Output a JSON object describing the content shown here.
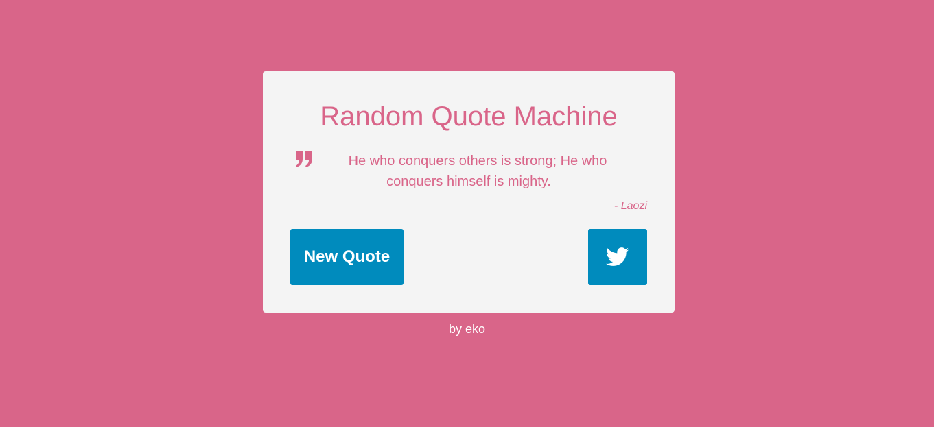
{
  "app": {
    "title": "Random Quote Machine"
  },
  "quote": {
    "text": "He who conquers others is strong; He who conquers himself is mighty.",
    "author": "- Laozi",
    "icon": "quote-right-icon"
  },
  "actions": {
    "new_quote_label": "New Quote",
    "tweet_icon": "twitter-icon"
  },
  "footer": {
    "credit": "by eko"
  },
  "colors": {
    "background": "#d96589",
    "card": "#f4f4f4",
    "accent": "#d96589",
    "button": "#008bbd",
    "button_text": "#ffffff"
  }
}
